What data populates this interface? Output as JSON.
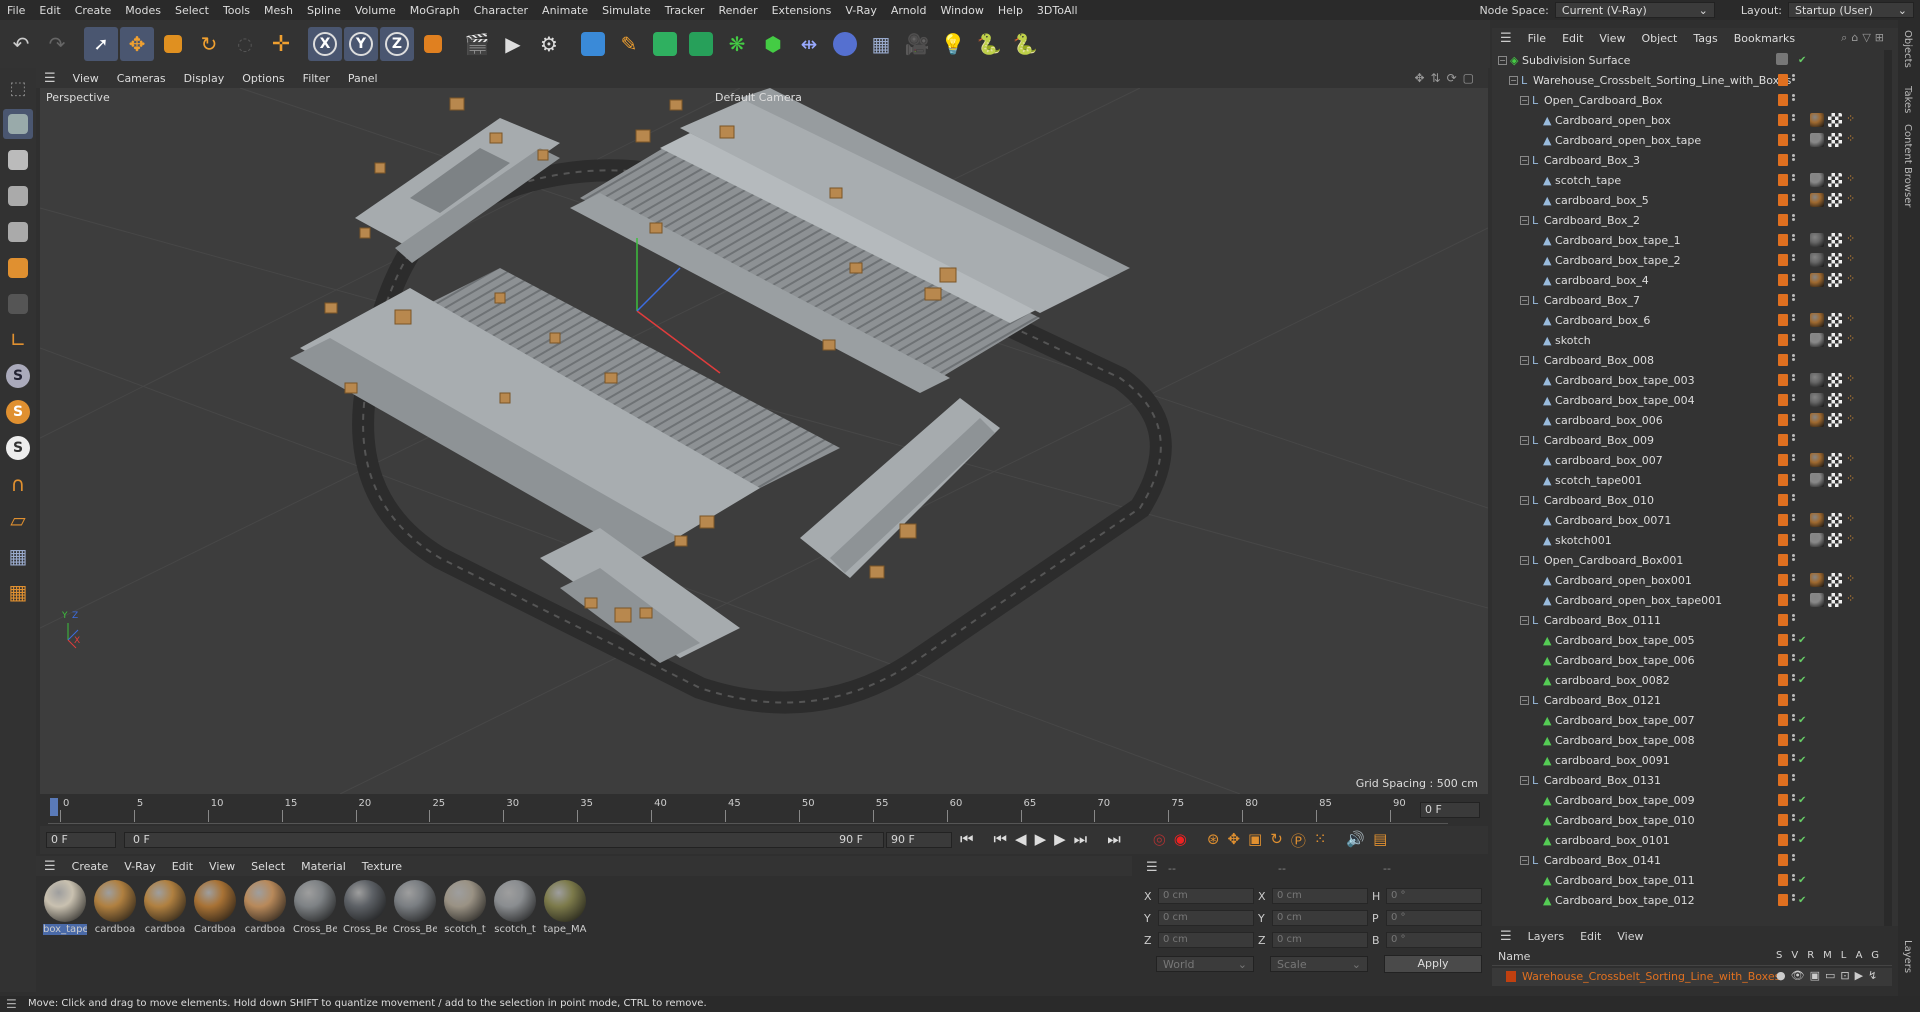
{
  "menubar": {
    "items": [
      "File",
      "Edit",
      "Create",
      "Modes",
      "Select",
      "Tools",
      "Mesh",
      "Spline",
      "Volume",
      "MoGraph",
      "Character",
      "Animate",
      "Simulate",
      "Tracker",
      "Render",
      "Extensions",
      "V-Ray",
      "Arnold",
      "Window",
      "Help",
      "3DToAll"
    ],
    "node_space_label": "Node Space:",
    "node_space_value": "Current (V-Ray)",
    "layout_label": "Layout:",
    "layout_value": "Startup (User)"
  },
  "viewport": {
    "menu": [
      "View",
      "Cameras",
      "Display",
      "Options",
      "Filter",
      "Panel"
    ],
    "view_name": "Perspective",
    "camera": "Default Camera",
    "grid_spacing": "Grid Spacing : 500 cm",
    "axis_y": "Y",
    "axis_z": "Z",
    "axis_x": "X"
  },
  "timeline": {
    "ticks": [
      "0",
      "5",
      "10",
      "15",
      "20",
      "25",
      "30",
      "35",
      "40",
      "45",
      "50",
      "55",
      "60",
      "65",
      "70",
      "75",
      "80",
      "85",
      "90"
    ],
    "current_frame": "0 F",
    "start_frame": "0 F",
    "range_start": "0 F",
    "range_end": "90 F",
    "end_frame": "90 F"
  },
  "materials": {
    "menu": [
      "Create",
      "V-Ray",
      "Edit",
      "View",
      "Select",
      "Material",
      "Texture"
    ],
    "items": [
      {
        "label": "box_tape",
        "color": "#c9c1b0"
      },
      {
        "label": "cardboa",
        "color": "#b08040"
      },
      {
        "label": "cardboa",
        "color": "#b08040"
      },
      {
        "label": "Cardboa",
        "color": "#a87235"
      },
      {
        "label": "cardboa",
        "color": "#b8895a"
      },
      {
        "label": "Cross_Be",
        "color": "#7e8285"
      },
      {
        "label": "Cross_Be",
        "color": "#5d6166"
      },
      {
        "label": "Cross_Be",
        "color": "#7a7e82"
      },
      {
        "label": "scotch_t",
        "color": "#9a9284"
      },
      {
        "label": "scotch_t",
        "color": "#8a8d90"
      },
      {
        "label": "tape_MA",
        "color": "#7c7a4a"
      }
    ]
  },
  "coords": {
    "header": [
      "--",
      "--",
      "--"
    ],
    "rows": [
      {
        "a": "X",
        "av": "0 cm",
        "b": "X",
        "bv": "0 cm",
        "c": "H",
        "cv": "0 °"
      },
      {
        "a": "Y",
        "av": "0 cm",
        "b": "Y",
        "bv": "0 cm",
        "c": "P",
        "cv": "0 °"
      },
      {
        "a": "Z",
        "av": "0 cm",
        "b": "Z",
        "bv": "0 cm",
        "c": "B",
        "cv": "0 °"
      }
    ],
    "world": "World",
    "scale": "Scale",
    "apply": "Apply"
  },
  "objects": {
    "menu": [
      "File",
      "Edit",
      "View",
      "Object",
      "Tags",
      "Bookmarks"
    ],
    "rows": [
      {
        "name": "Subdivision Surface",
        "depth": 0,
        "type": "sub"
      },
      {
        "name": "Warehouse_Crossbelt_Sorting_Line_with_Boxes",
        "depth": 1,
        "type": "null"
      },
      {
        "name": "Open_Cardboard_Box",
        "depth": 2,
        "type": "null"
      },
      {
        "name": "Cardboard_open_box",
        "depth": 3,
        "type": "mesh",
        "tex": "#a06a30"
      },
      {
        "name": "Cardboard_open_box_tape",
        "depth": 3,
        "type": "mesh",
        "tex": "#888"
      },
      {
        "name": "Cardboard_Box_3",
        "depth": 2,
        "type": "null"
      },
      {
        "name": "scotch_tape",
        "depth": 3,
        "type": "mesh",
        "tex": "#888"
      },
      {
        "name": "cardboard_box_5",
        "depth": 3,
        "type": "mesh",
        "tex": "#a06a30"
      },
      {
        "name": "Cardboard_Box_2",
        "depth": 2,
        "type": "null"
      },
      {
        "name": "Cardboard_box_tape_1",
        "depth": 3,
        "type": "mesh",
        "tex": "#666"
      },
      {
        "name": "Cardboard_box_tape_2",
        "depth": 3,
        "type": "mesh",
        "tex": "#666"
      },
      {
        "name": "cardboard_box_4",
        "depth": 3,
        "type": "mesh",
        "tex": "#a06a30"
      },
      {
        "name": "Cardboard_Box_7",
        "depth": 2,
        "type": "null"
      },
      {
        "name": "Cardboard_box_6",
        "depth": 3,
        "type": "mesh",
        "tex": "#a06a30"
      },
      {
        "name": "skotch",
        "depth": 3,
        "type": "mesh",
        "tex": "#888"
      },
      {
        "name": "Cardboard_Box_008",
        "depth": 2,
        "type": "null"
      },
      {
        "name": "Cardboard_box_tape_003",
        "depth": 3,
        "type": "mesh",
        "tex": "#666"
      },
      {
        "name": "Cardboard_box_tape_004",
        "depth": 3,
        "type": "mesh",
        "tex": "#666"
      },
      {
        "name": "cardboard_box_006",
        "depth": 3,
        "type": "mesh",
        "tex": "#a06a30"
      },
      {
        "name": "Cardboard_Box_009",
        "depth": 2,
        "type": "null"
      },
      {
        "name": "cardboard_box_007",
        "depth": 3,
        "type": "mesh",
        "tex": "#a06a30"
      },
      {
        "name": "scotch_tape001",
        "depth": 3,
        "type": "mesh",
        "tex": "#888"
      },
      {
        "name": "Cardboard_Box_010",
        "depth": 2,
        "type": "null"
      },
      {
        "name": "Cardboard_box_0071",
        "depth": 3,
        "type": "mesh",
        "tex": "#a06a30"
      },
      {
        "name": "skotch001",
        "depth": 3,
        "type": "mesh",
        "tex": "#888"
      },
      {
        "name": "Open_Cardboard_Box001",
        "depth": 2,
        "type": "null"
      },
      {
        "name": "Cardboard_open_box001",
        "depth": 3,
        "type": "mesh",
        "tex": "#a06a30"
      },
      {
        "name": "Cardboard_open_box_tape001",
        "depth": 3,
        "type": "mesh",
        "tex": "#888"
      },
      {
        "name": "Cardboard_Box_0111",
        "depth": 2,
        "type": "null"
      },
      {
        "name": "Cardboard_box_tape_005",
        "depth": 3,
        "type": "poly"
      },
      {
        "name": "Cardboard_box_tape_006",
        "depth": 3,
        "type": "poly"
      },
      {
        "name": "cardboard_box_0082",
        "depth": 3,
        "type": "poly"
      },
      {
        "name": "Cardboard_Box_0121",
        "depth": 2,
        "type": "null"
      },
      {
        "name": "Cardboard_box_tape_007",
        "depth": 3,
        "type": "poly"
      },
      {
        "name": "Cardboard_box_tape_008",
        "depth": 3,
        "type": "poly"
      },
      {
        "name": "cardboard_box_0091",
        "depth": 3,
        "type": "poly"
      },
      {
        "name": "Cardboard_Box_0131",
        "depth": 2,
        "type": "null"
      },
      {
        "name": "Cardboard_box_tape_009",
        "depth": 3,
        "type": "poly"
      },
      {
        "name": "Cardboard_box_tape_010",
        "depth": 3,
        "type": "poly"
      },
      {
        "name": "cardboard_box_0101",
        "depth": 3,
        "type": "poly"
      },
      {
        "name": "Cardboard_Box_0141",
        "depth": 2,
        "type": "null"
      },
      {
        "name": "Cardboard_box_tape_011",
        "depth": 3,
        "type": "poly"
      },
      {
        "name": "Cardboard_box_tape_012",
        "depth": 3,
        "type": "poly"
      }
    ]
  },
  "layers": {
    "menu": [
      "Layers",
      "Edit",
      "View"
    ],
    "header_name": "Name",
    "cols": [
      "S",
      "V",
      "R",
      "M",
      "L",
      "A",
      "G"
    ],
    "row_name": "Warehouse_Crossbelt_Sorting_Line_with_Boxes"
  },
  "side_tabs": [
    "Objects",
    "Takes",
    "Content Browser",
    "Layers"
  ],
  "status": "Move: Click and drag to move elements. Hold down SHIFT to quantize movement / add to the selection in point mode, CTRL to remove."
}
